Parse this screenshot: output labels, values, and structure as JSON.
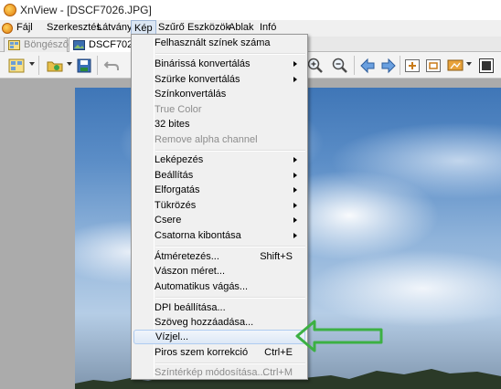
{
  "window": {
    "title": "XnView - [DSCF7026.JPG]"
  },
  "menubar": {
    "items": [
      {
        "label": "Fájl"
      },
      {
        "label": "Szerkesztés"
      },
      {
        "label": "Látvány"
      },
      {
        "label": "Kép",
        "active": true
      },
      {
        "label": "Szűrő"
      },
      {
        "label": "Eszközök"
      },
      {
        "label": "Ablak"
      },
      {
        "label": "Infó"
      }
    ]
  },
  "tabs": [
    {
      "label": "Böngésző",
      "active": false,
      "icon": "browser-icon"
    },
    {
      "label": "DSCF7026.JPG",
      "active": true,
      "icon": "image-icon"
    }
  ],
  "toolbar": {
    "buttons": [
      "open-folder-icon",
      "browse-icon",
      "save-icon",
      "undo-icon",
      "zoom-in-icon",
      "zoom-out-icon",
      "previous-icon",
      "next-icon",
      "fit-window-icon",
      "actual-size-icon",
      "slideshow-icon",
      "fullscreen-icon"
    ]
  },
  "image_menu": {
    "items": [
      {
        "label": "Felhasznált színek száma"
      },
      {
        "separator": true
      },
      {
        "label": "Binárissá konvertálás",
        "submenu": true
      },
      {
        "label": "Szürke konvertálás",
        "submenu": true
      },
      {
        "label": "Színkonvertálás"
      },
      {
        "label": "True Color",
        "disabled": true
      },
      {
        "label": "32 bites"
      },
      {
        "label": "Remove alpha channel",
        "disabled": true
      },
      {
        "separator": true
      },
      {
        "label": "Leképezés",
        "submenu": true
      },
      {
        "label": "Beállítás",
        "submenu": true
      },
      {
        "label": "Elforgatás",
        "submenu": true
      },
      {
        "label": "Tükrözés",
        "submenu": true
      },
      {
        "label": "Csere",
        "submenu": true
      },
      {
        "label": "Csatorna kibontása",
        "submenu": true
      },
      {
        "separator": true
      },
      {
        "label": "Átméretezés...",
        "shortcut": "Shift+S"
      },
      {
        "label": "Vászon méret..."
      },
      {
        "label": "Automatikus vágás..."
      },
      {
        "separator": true
      },
      {
        "label": "DPI beállítása..."
      },
      {
        "label": "Szöveg hozzáadása..."
      },
      {
        "label": "Vízjel...",
        "hover": true
      },
      {
        "label": "Piros szem korrekció",
        "shortcut": "Ctrl+E"
      },
      {
        "separator": true
      },
      {
        "label": "Színtérkép módosítása...",
        "shortcut": "Ctrl+M",
        "disabled": true
      }
    ]
  },
  "annotation": {
    "color": "#3cb043",
    "points_to": "Vízjel..."
  }
}
